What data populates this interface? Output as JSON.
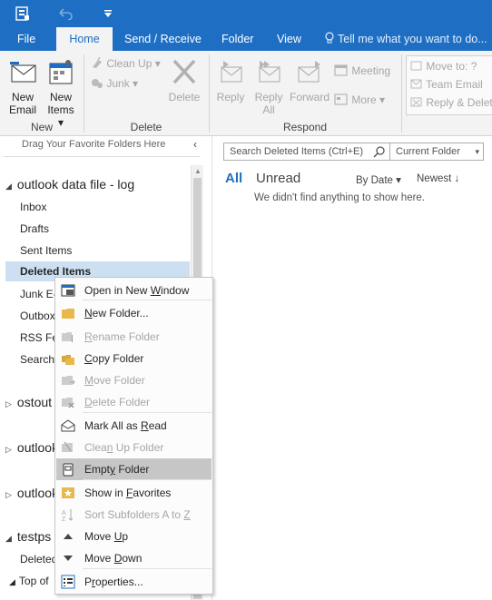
{
  "titlebar": {
    "undo_icon": "undo-icon",
    "customize_icon": "customize-quick-access-icon"
  },
  "tabs": [
    {
      "label": "File"
    },
    {
      "label": "Home",
      "active": true
    },
    {
      "label": "Send / Receive"
    },
    {
      "label": "Folder"
    },
    {
      "label": "View"
    }
  ],
  "tellme": "Tell me what you want to do...",
  "ribbon": {
    "new_group": {
      "label": "New",
      "new_email": [
        "New",
        "Email"
      ],
      "new_items": [
        "New",
        "Items ▾"
      ]
    },
    "delete_group": {
      "label": "Delete",
      "clean_up": "Clean Up ▾",
      "junk": "Junk ▾",
      "delete": "Delete"
    },
    "respond_group": {
      "label": "Respond",
      "reply": "Reply",
      "reply_all": [
        "Reply",
        "All"
      ],
      "forward": "Forward",
      "meeting": "Meeting",
      "more": "More ▾"
    },
    "quicksteps": {
      "move_to": "Move to: ?",
      "team_email": "Team Email",
      "reply_delete": "Reply & Delet"
    }
  },
  "navpane": {
    "drag_favorites": "Drag Your Favorite Folders Here",
    "collapse": "‹",
    "account": "outlook data file - log",
    "folders": [
      "Inbox",
      "Drafts",
      "Sent Items",
      "Deleted Items",
      "Junk E-",
      "Outbox",
      "RSS Fee",
      "Search"
    ],
    "other_accounts": [
      "ostout",
      "outlook",
      "outlook"
    ],
    "testps": "testps",
    "testps_folders": [
      "Deleted",
      "Top of"
    ]
  },
  "msglist": {
    "search_placeholder": "Search Deleted Items (Ctrl+E)",
    "scope": "Current Folder",
    "filter_all": "All",
    "filter_unread": "Unread",
    "sort": "By Date ▾",
    "order": "Newest ↓",
    "empty_text": "We didn't find anything to show here."
  },
  "context_menu": {
    "items": [
      {
        "pre": "Open in New ",
        "u": "W",
        "post": "indow",
        "enabled": true,
        "icon": "open-new-window-icon"
      },
      {
        "pre": "",
        "u": "N",
        "post": "ew Folder...",
        "enabled": true,
        "icon": "new-folder-icon"
      },
      {
        "pre": "",
        "u": "R",
        "post": "ename Folder",
        "enabled": false,
        "icon": "rename-folder-icon"
      },
      {
        "pre": "",
        "u": "C",
        "post": "opy Folder",
        "enabled": true,
        "icon": "copy-folder-icon"
      },
      {
        "pre": "",
        "u": "M",
        "post": "ove Folder",
        "enabled": false,
        "icon": "move-folder-icon"
      },
      {
        "pre": "",
        "u": "D",
        "post": "elete Folder",
        "enabled": false,
        "icon": "delete-folder-icon"
      },
      {
        "pre": "Mark All as ",
        "u": "R",
        "post": "ead",
        "enabled": true,
        "icon": "mark-read-icon"
      },
      {
        "pre": "Clea",
        "u": "n",
        "post": " Up Folder",
        "enabled": false,
        "icon": "clean-up-folder-icon"
      },
      {
        "pre": "Empt",
        "u": "y",
        "post": " Folder",
        "enabled": true,
        "highlighted": true,
        "icon": "empty-folder-icon"
      },
      {
        "pre": "Show in ",
        "u": "F",
        "post": "avorites",
        "enabled": true,
        "icon": "favorites-icon"
      },
      {
        "pre": "Sort Subfolders A to ",
        "u": "Z",
        "post": "",
        "enabled": false,
        "icon": "sort-az-icon"
      },
      {
        "pre": "Move ",
        "u": "U",
        "post": "p",
        "enabled": true,
        "icon": "move-up-icon"
      },
      {
        "pre": "Move ",
        "u": "D",
        "post": "own",
        "enabled": true,
        "icon": "move-down-icon"
      },
      {
        "pre": "P",
        "u": "r",
        "post": "operties...",
        "enabled": true,
        "icon": "properties-icon"
      }
    ]
  },
  "colors": {
    "accent": "#1e6fc4",
    "ribbon": "#f3f3f3",
    "selected_folder": "#cde0f2",
    "menu_highlight": "#c6c6c6",
    "disabled_text": "#a6a6a6"
  }
}
